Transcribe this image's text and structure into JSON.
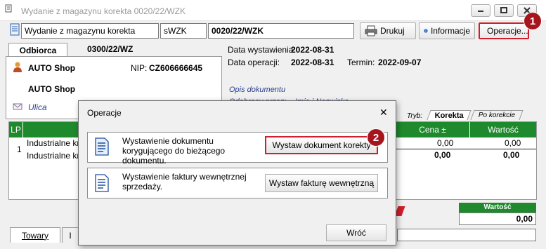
{
  "window": {
    "title": "Wydanie z magazynu korekta 0020/22/WZK"
  },
  "toolbar": {
    "doc_type": "Wydanie z magazynu korekta",
    "series": "sWZK",
    "number": "0020/22/WZK",
    "print_label": "Drukuj",
    "info_label": "Informacje",
    "operations_label": "Operacje..."
  },
  "header": {
    "tab_odbiorca": "Odbiorca",
    "wz_number": "0300/22/WZ",
    "company_name": "AUTO Shop",
    "nip_label": "NIP:",
    "nip_value": "CZ606666645",
    "company_name2": "AUTO Shop",
    "street": "Ulica",
    "issue_date_label": "Data wystawienia:",
    "issue_date": "2022-08-31",
    "op_date_label": "Data operacji:",
    "op_date": "2022-08-31",
    "term_label": "Termin:",
    "term_date": "2022-09-07",
    "description_label": "Opis dokumentu",
    "receiver_label": "Odebrany przez:",
    "receiver_value": "Imię i Nazwisko"
  },
  "grid_tabs": {
    "mode_label": "Tryb:",
    "korekta": "Korekta",
    "po_korekcie": "Po korekcie"
  },
  "grid": {
    "col_lp": "LP",
    "col_cena": "Cena ±",
    "col_wartosc": "Wartość",
    "rows": [
      {
        "lp": "1",
        "name": "Industrialne krz",
        "cena": "0,00",
        "wartosc": "0,00"
      },
      {
        "lp": "",
        "name": "Industrialne krz",
        "cena": "0,00",
        "wartosc": "0,00"
      }
    ]
  },
  "footer": {
    "total_label": "Wartość",
    "total_value": "0,00",
    "tab_towary": "Towary",
    "tab_second": "I"
  },
  "dialog": {
    "title": "Operacje",
    "close": "✕",
    "option1_text": "Wystawienie dokumentu korygującego do bieżącego dokumentu.",
    "option1_button": "Wystaw dokument korekty",
    "option2_text": "Wystawienie faktury wewnętrznej sprzedaży.",
    "option2_button": "Wystaw fakturę wewnętrzną",
    "back_button": "Wróć"
  },
  "annotations": {
    "badge1": "1",
    "badge2": "2"
  },
  "colors": {
    "accent_red": "#d01f2a",
    "badge": "#a6151e",
    "grid_header": "#1f8a2d"
  }
}
